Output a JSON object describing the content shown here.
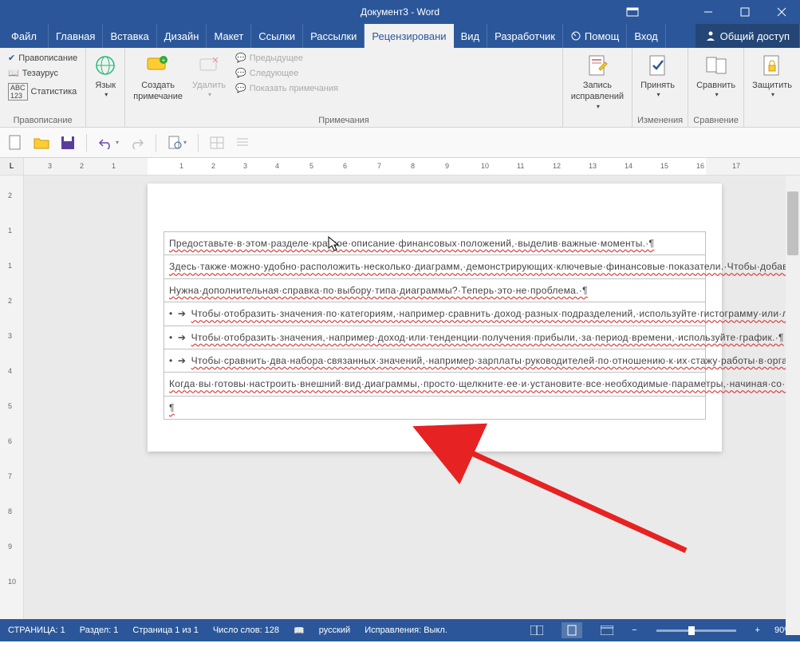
{
  "window": {
    "title": "Документ3 - Word"
  },
  "tabs": {
    "file": "Файл",
    "home": "Главная",
    "insert": "Вставка",
    "design": "Дизайн",
    "layout": "Макет",
    "references": "Ссылки",
    "mailings": "Рассылки",
    "review": "Рецензировани",
    "view": "Вид",
    "developer": "Разработчик",
    "help": "Помощ",
    "signin": "Вход",
    "share": "Общий доступ"
  },
  "ribbon": {
    "proofing": {
      "spelling": "Правописание",
      "thesaurus": "Тезаурус",
      "stats": "Статистика",
      "label": "Правописание"
    },
    "language": {
      "btn": "Язык"
    },
    "comments": {
      "new": "Создать\nпримечание",
      "delete": "Удалить",
      "prev": "Предыдущее",
      "next": "Следующее",
      "show": "Показать примечания",
      "label": "Примечания"
    },
    "tracking": {
      "btn": "Запись\nисправлений"
    },
    "changes": {
      "accept": "Принять",
      "label": "Изменения"
    },
    "compare": {
      "btn": "Сравнить",
      "label": "Сравнение"
    },
    "protect": {
      "btn": "Защитить"
    }
  },
  "ruler": {
    "h_nums": [
      "3",
      "2",
      "1",
      "1",
      "2",
      "3",
      "4",
      "5",
      "6",
      "7",
      "8",
      "9",
      "10",
      "11",
      "12",
      "13",
      "14",
      "15",
      "16",
      "17"
    ]
  },
  "document": {
    "rows": [
      "Предоставьте·в·этом·разделе·краткое·описание·финансовых·положений,·выделив·важные·моменты.·¶",
      "Здесь·также·можно·удобно·расположить·несколько·диаграмм,·демонстрирующих·ключевые·финансовые·показатели.·Чтобы·добавить·диаграмму,·на·вкладке·«Вставка»·выберите·команду·«Диаграмма».·Диаграмма·будет·автоматически·оформлена·в·соответствии·с·видом·отчета.¶",
      "Нужна·дополнительная·справка·по·выбору·типа·диаграммы?·Теперь·это·не·проблема.·¶",
      "Чтобы·отобразить·значения·по·категориям,·например·сравнить·доход·разных·подразделений,·используйте·гистограмму·или·линейчатую·диаграмму.·¶",
      "Чтобы·отобразить·значения,·например·доход·или·тенденции·получения·прибыли,·за·период·времени,·используйте·график.·¶",
      "Чтобы·сравнить·два·набора·связанных·значений,·например·зарплаты·руководителей·по·отношению·к·их·стажу·работы·в·организации,·воспользуйтесь·точечной·диаграммой.·¶",
      "Когда·вы·готовы·настроить·внешний·вид·диаграммы,·просто·щелкните·ее·и·установите·все·необходимые·параметры,·начиная·со·стиля·и·макета·и·заканчивая·управлением·данных,·с·помощью·значков·справа.¶",
      "¶"
    ]
  },
  "status": {
    "page": "СТРАНИЦА: 1",
    "section": "Раздел: 1",
    "page_of": "Страница 1 из 1",
    "words": "Число слов: 128",
    "lang": "русский",
    "track": "Исправления: Выкл.",
    "zoom": "90%"
  }
}
